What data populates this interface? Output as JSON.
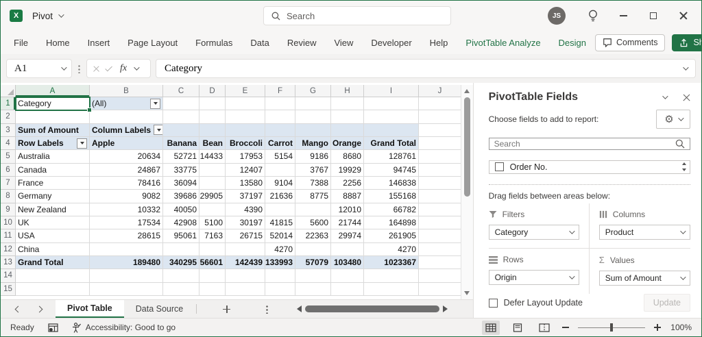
{
  "titlebar": {
    "doc_title": "Pivot",
    "search_placeholder": "Search",
    "avatar_initials": "JS"
  },
  "ribbon": {
    "tabs": [
      "File",
      "Home",
      "Insert",
      "Page Layout",
      "Formulas",
      "Data",
      "Review",
      "View",
      "Developer",
      "Help"
    ],
    "contextual_tabs": [
      "PivotTable Analyze",
      "Design"
    ],
    "comments_label": "Comments",
    "share_label": "Share"
  },
  "formula_bar": {
    "name_box": "A1",
    "fx_label": "fx",
    "value": "Category"
  },
  "grid": {
    "column_letters": [
      "A",
      "B",
      "C",
      "D",
      "E",
      "F",
      "G",
      "H",
      "I",
      "J"
    ],
    "row_count": 15,
    "selected_cell": "A1",
    "selected_column": "A",
    "selected_row": 1
  },
  "pivot": {
    "filter_field": "Category",
    "filter_value": "(All)",
    "values_header": "Sum of Amount",
    "column_labels_header": "Column Labels",
    "row_labels_header": "Row Labels",
    "column_fields": [
      "Apple",
      "Banana",
      "Bean",
      "Broccoli",
      "Carrot",
      "Mango",
      "Orange",
      "Grand Total"
    ],
    "rows": [
      {
        "label": "Australia",
        "values": [
          "20634",
          "52721",
          "14433",
          "17953",
          "5154",
          "9186",
          "8680",
          "128761"
        ]
      },
      {
        "label": "Canada",
        "values": [
          "24867",
          "33775",
          "",
          "12407",
          "",
          "3767",
          "19929",
          "94745"
        ]
      },
      {
        "label": "France",
        "values": [
          "78416",
          "36094",
          "",
          "13580",
          "9104",
          "7388",
          "2256",
          "146838"
        ]
      },
      {
        "label": "Germany",
        "values": [
          "9082",
          "39686",
          "29905",
          "37197",
          "21636",
          "8775",
          "8887",
          "155168"
        ]
      },
      {
        "label": "New Zealand",
        "values": [
          "10332",
          "40050",
          "",
          "4390",
          "",
          "",
          "12010",
          "66782"
        ]
      },
      {
        "label": "UK",
        "values": [
          "17534",
          "42908",
          "5100",
          "30197",
          "41815",
          "5600",
          "21744",
          "164898"
        ]
      },
      {
        "label": "USA",
        "values": [
          "28615",
          "95061",
          "7163",
          "26715",
          "52014",
          "22363",
          "29974",
          "261905"
        ]
      },
      {
        "label": "China",
        "values": [
          "",
          "",
          "",
          "",
          "4270",
          "",
          "",
          "4270"
        ]
      }
    ],
    "grand_total": {
      "label": "Grand Total",
      "values": [
        "189480",
        "340295",
        "56601",
        "142439",
        "133993",
        "57079",
        "103480",
        "1023367"
      ]
    }
  },
  "fields_pane": {
    "title": "PivotTable Fields",
    "choose_label": "Choose fields to add to report:",
    "search_placeholder": "Search",
    "field_items": [
      {
        "label": "Order No.",
        "checked": false
      }
    ],
    "drag_label": "Drag fields between areas below:",
    "areas": {
      "filters": {
        "label": "Filters",
        "value": "Category"
      },
      "columns": {
        "label": "Columns",
        "value": "Product"
      },
      "rows": {
        "label": "Rows",
        "value": "Origin"
      },
      "values": {
        "label": "Values",
        "value": "Sum of Amount"
      }
    },
    "defer_label": "Defer Layout Update",
    "update_label": "Update"
  },
  "sheet_tabs": {
    "tabs": [
      {
        "label": "Pivot Table",
        "active": true
      },
      {
        "label": "Data Source",
        "active": false
      }
    ]
  },
  "status_bar": {
    "ready": "Ready",
    "accessibility": "Accessibility: Good to go",
    "zoom": "100%"
  },
  "icons": {
    "sigma": "Σ",
    "gear": "⚙"
  },
  "colors": {
    "accent_green": "#217346",
    "pivot_blue": "#dce6f1",
    "selection_green": "#217346"
  }
}
